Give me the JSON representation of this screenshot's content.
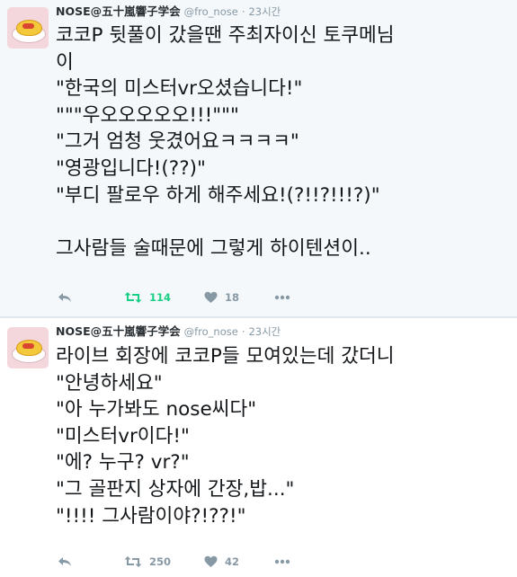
{
  "tweets": [
    {
      "user": {
        "name": "NOSE@五十嵐響子学会",
        "handle": "@fro_nose",
        "time": "23시간"
      },
      "lines": [
        "코코P 뒷풀이 갔을땐 주최자이신 토쿠메님",
        "이",
        "\"한국의 미스터vr오셨습니다!\"",
        "\"\"\"우오오오오오!!!\"\"\"",
        "\"그거 엄청 웃겼어요ㅋㅋㅋㅋ\"",
        "\"영광입니다!(??)\"",
        "\"부디 팔로우 하게 해주세요!(?!!?!!!?)\"",
        "",
        "그사람들 술때문에 그렇게 하이텐션이.."
      ],
      "actions": {
        "retweets": "114",
        "likes": "18",
        "retweeted": true
      }
    },
    {
      "user": {
        "name": "NOSE@五十嵐響子学会",
        "handle": "@fro_nose",
        "time": "23시간"
      },
      "lines": [
        "라이브 회장에 코코P들 모여있는데 갔더니",
        "\"안녕하세요\"",
        "\"아 누가봐도 nose씨다\"",
        "\"미스터vr이다!\"",
        "\"에? 누구? vr?\"",
        "\"그 골판지 상자에 간장,밥...\"",
        "\"!!!! 그사람이야?!??!\""
      ],
      "actions": {
        "retweets": "250",
        "likes": "42",
        "retweeted": false
      }
    }
  ],
  "icons": {
    "reply": "reply-icon",
    "retweet": "retweet-icon",
    "like": "heart-icon",
    "more": "more-icon"
  },
  "colors": {
    "retweet_active": "#19cf86",
    "icon_gray": "#8899a6",
    "selected_bg": "#f5f8fa"
  }
}
